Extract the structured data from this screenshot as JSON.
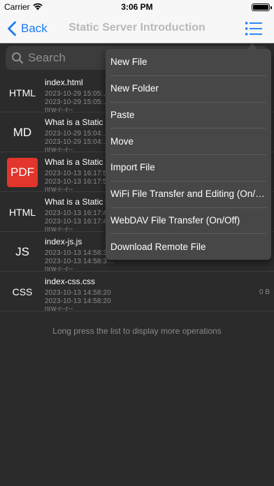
{
  "status_bar": {
    "carrier": "Carrier",
    "time": "3:06 PM"
  },
  "nav": {
    "back_label": "Back",
    "title": "Static Server Introduction"
  },
  "search": {
    "placeholder": "Search"
  },
  "files": [
    {
      "icon": "HTML",
      "name": "index.html",
      "meta1": "2023-10-29 15:05:…",
      "meta2": "2023-10-29 15:05:…",
      "meta3": "nrw-r--r--",
      "size": ""
    },
    {
      "icon": "MD",
      "name": "What is a Static …",
      "meta1": "2023-10-29 15:04:…",
      "meta2": "2023-10-29 15:04:…",
      "meta3": "nrw-r--r--",
      "size": ""
    },
    {
      "icon": "PDF",
      "name": "What is a Static …",
      "meta1": "2023-10-13 16:17:5…",
      "meta2": "2023-10-13 16:17:5…",
      "meta3": "nrw-r--r--",
      "size": ""
    },
    {
      "icon": "HTML",
      "name": "What is a Static …",
      "meta1": "2023-10-13 16:17:4…",
      "meta2": "2023-10-13 16:17:4…",
      "meta3": "nrw-r--r--",
      "size": ""
    },
    {
      "icon": "JS",
      "name": "index-js.js",
      "meta1": "2023-10-13 14:58:3…",
      "meta2": "2023-10-13 14:58:3…",
      "meta3": "nrw-r--r--",
      "size": ""
    },
    {
      "icon": "CSS",
      "name": "index-css.css",
      "meta1": "2023-10-13 14:58:20",
      "meta2": "2023-10-13 14:58:20",
      "meta3": "nrw-r--r--",
      "size": "0 B"
    }
  ],
  "hint": "Long press the list to display more operations",
  "menu": {
    "items": [
      "New File",
      "New Folder",
      "Paste",
      "Move",
      "Import File",
      "WiFi File Transfer and Editing (On/…",
      "WebDAV File Transfer (On/Off)",
      "Download Remote File"
    ]
  },
  "colors": {
    "accent": "#1a7cf5",
    "pdf_badge": "#e2352c",
    "background": "#2b2b2b"
  }
}
